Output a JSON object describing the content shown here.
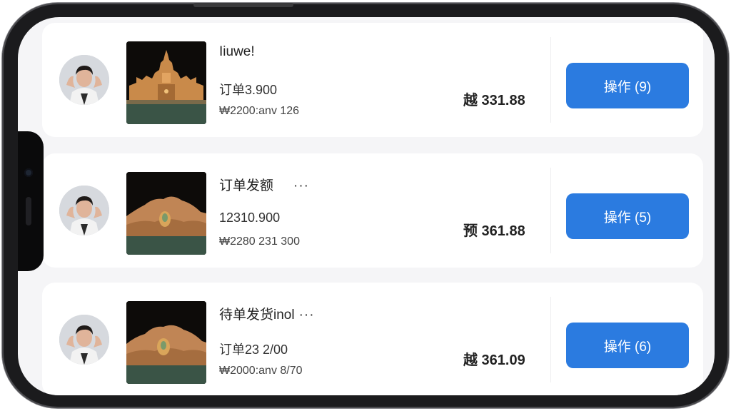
{
  "orders": [
    {
      "title": "Iiuwe!",
      "has_more": false,
      "order_line": "订单3.900",
      "meta_line": "₩2200:anv 126",
      "price": "越 331.88",
      "action_label": "操作 (9)",
      "thumb_icon": "pagoda-temple-image"
    },
    {
      "title": "订单发额",
      "has_more": true,
      "more_label": "···",
      "order_line": "12310.900",
      "meta_line": "₩2280 231 300",
      "price": "预 361.88",
      "action_label": "操作 (5)",
      "thumb_icon": "golden-rock-image"
    },
    {
      "title": "待单发货inol",
      "has_more": true,
      "more_label": "···",
      "order_line": "订单23 2/00",
      "meta_line": "₩2000:anv 8/70",
      "price": "越 361.09",
      "action_label": "操作 (6)",
      "thumb_icon": "golden-rock-image"
    }
  ],
  "colors": {
    "accent": "#2b7be0",
    "screen_bg": "#f5f5f7",
    "card_bg": "#ffffff"
  }
}
